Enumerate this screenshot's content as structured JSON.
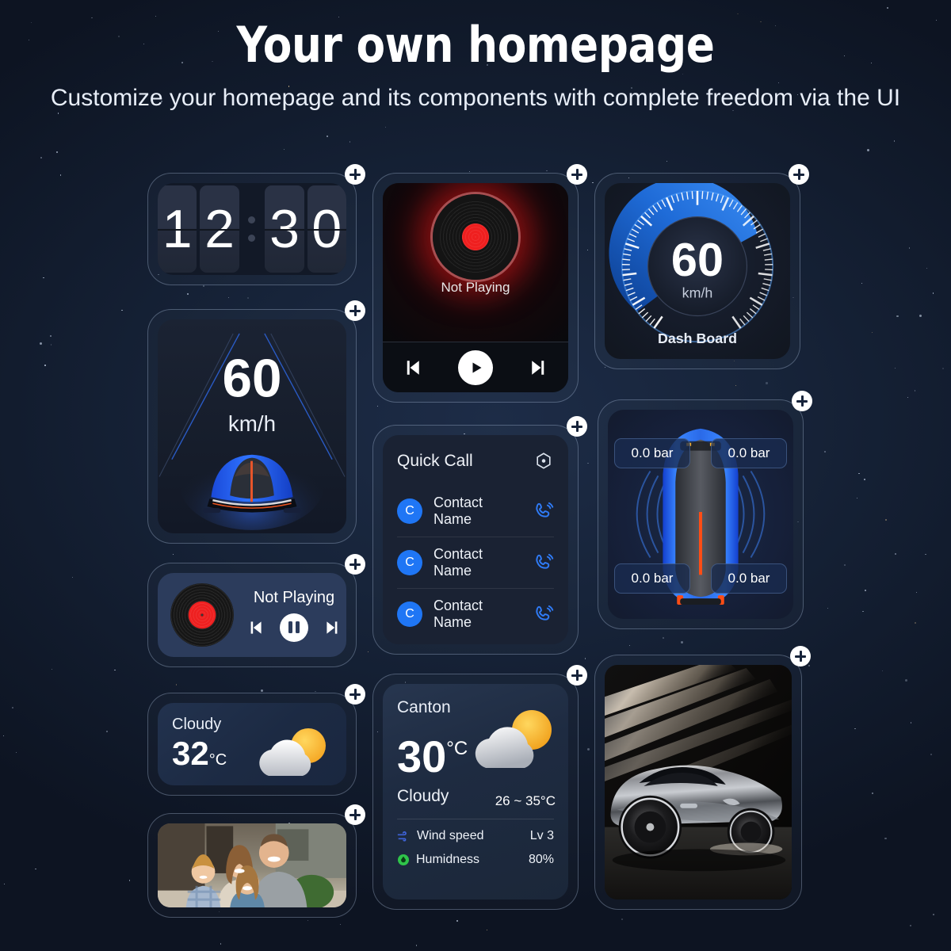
{
  "header": {
    "title": "Your own homepage",
    "subtitle": "Customize your homepage and its components with complete freedom via the UI"
  },
  "add_badge": {
    "label": "+",
    "icon": "plus-icon"
  },
  "widgets": {
    "clock": {
      "name": "flip-clock",
      "hours": "12",
      "minutes": "30",
      "digits": [
        "1",
        "2",
        "3",
        "0"
      ],
      "separator": ":"
    },
    "media_large": {
      "name": "media-player-large",
      "status": "Not Playing",
      "controls": [
        "previous-track",
        "play",
        "next-track"
      ],
      "accent": "#ef1f1f"
    },
    "dashboard": {
      "name": "dashboard-gauge",
      "value": "60",
      "unit": "km/h",
      "label": "Dash Board",
      "accent": "#1f6fe0",
      "gauge_percent": 58
    },
    "speed": {
      "name": "speed-display",
      "value": "60",
      "unit": "km/h"
    },
    "quick_call": {
      "name": "quick-call",
      "title": "Quick Call",
      "settings_icon": "hexagon-settings-icon",
      "contacts": [
        {
          "initial": "C",
          "name": "Contact Name",
          "action_icon": "phone-icon"
        },
        {
          "initial": "C",
          "name": "Contact Name",
          "action_icon": "phone-icon"
        },
        {
          "initial": "C",
          "name": "Contact Name",
          "action_icon": "phone-icon"
        }
      ],
      "avatar_color": "#1f76f5"
    },
    "tpms": {
      "name": "tire-pressure-monitor",
      "tires": [
        {
          "position": "front-left",
          "value": "0.0 bar"
        },
        {
          "position": "front-right",
          "value": "0.0 bar"
        },
        {
          "position": "rear-left",
          "value": "0.0 bar"
        },
        {
          "position": "rear-right",
          "value": "0.0 bar"
        }
      ]
    },
    "media_small": {
      "name": "media-player-small",
      "status": "Not Playing",
      "controls": [
        "previous-track",
        "pause",
        "next-track"
      ]
    },
    "weather_small": {
      "name": "weather-compact",
      "condition": "Cloudy",
      "temperature": "32",
      "unit": "°C",
      "icon": "sun-behind-cloud-icon"
    },
    "weather_large": {
      "name": "weather-detailed",
      "city": "Canton",
      "temperature": "30",
      "unit": "°C",
      "range": "26 ~ 35°C",
      "condition": "Cloudy",
      "icon": "sun-behind-cloud-icon",
      "details": [
        {
          "icon": "wind-icon",
          "label": "Wind speed",
          "value": "Lv 3",
          "color": "#3e63d8"
        },
        {
          "icon": "humidity-icon",
          "label": "Humidness",
          "value": "80%",
          "color": "#2fc44a"
        }
      ]
    },
    "photo_family": {
      "name": "photo-family",
      "alt": "Family photo"
    },
    "photo_car": {
      "name": "photo-car",
      "alt": "Silver sports car with light streaks"
    }
  },
  "colors": {
    "background": "#141f33",
    "accent_blue": "#1f76f5",
    "accent_red": "#ef1f1f",
    "card_border": "rgba(175,195,225,0.34)"
  }
}
